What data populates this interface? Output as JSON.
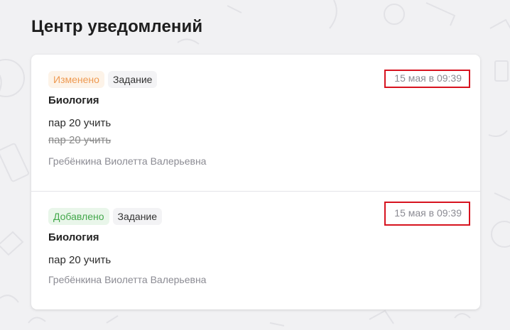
{
  "page": {
    "title": "Центр уведомлений"
  },
  "notifications": [
    {
      "status": "Изменено",
      "type": "Задание",
      "subject": "Биология",
      "new_text": "пар 20 учить",
      "old_text": "пар 20 учить",
      "author": "Гребёнкина Виолетта Валерьевна",
      "date": "15 мая в 09:39"
    },
    {
      "status": "Добавлено",
      "type": "Задание",
      "subject": "Биология",
      "new_text": "пар 20 учить",
      "author": "Гребёнкина Виолетта Валерьевна",
      "date": "15 мая в 09:39"
    }
  ],
  "colors": {
    "changed": "#ee9a52",
    "added": "#43a84b",
    "highlight_border": "#d7131f"
  }
}
